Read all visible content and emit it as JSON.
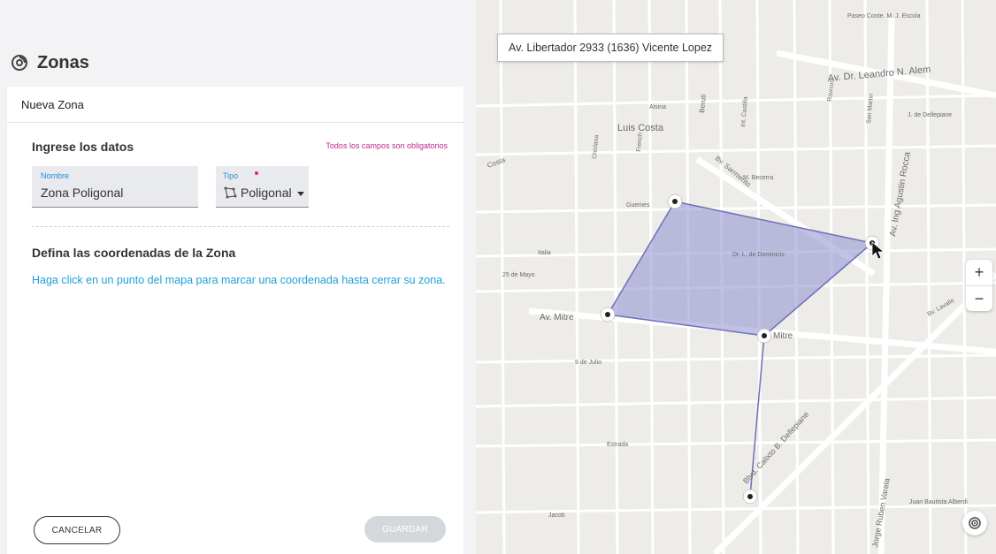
{
  "header": {
    "title": "Zonas"
  },
  "card": {
    "head_title": "Nueva Zona",
    "section_title": "Ingrese los datos",
    "required_note": "Todos los campos son obligatorios",
    "nombre_label": "Nombre",
    "nombre_value": "Zona Poligonal",
    "tipo_label": "Tipo",
    "tipo_value": "Poligonal",
    "coords_title": "Defina las coordenadas de la Zona",
    "instructions": "Haga click en un punto del mapa para marcar una coordenada hasta cerrar su zona.",
    "cancel_label": "CANCELAR",
    "save_label": "GUARDAR"
  },
  "map": {
    "address": "Av. Libertador 2933 (1636) Vicente Lopez",
    "zoom_in": "+",
    "zoom_out": "−",
    "streets": [
      "Av. Dr. Leandro N. Alem",
      "Luis Costa",
      "Guemes",
      "M. Becerra",
      "Italia",
      "Dr. L. de Dominicis",
      "25 de Mayo",
      "Av. Mitre",
      "9 de Julio",
      "Estrada",
      "Jacob",
      "Av. Ing Agustin Rocca",
      "Blvd. Calixto B. Dellepiane",
      "Jorge Ruben Varela",
      "Juan Bautista Alberdi",
      "Costa",
      "Bv. Sarmiento",
      "J. de Dellepiane",
      "Alsina",
      "Beruti",
      "Int. Castilla",
      "San Martin",
      "Chiclana",
      "French",
      "Rawson",
      "Mitre",
      "Bv. Lavalle",
      "Paseo Conte. M. J. Escola"
    ],
    "accent_polygon": "#8d8fd0"
  }
}
